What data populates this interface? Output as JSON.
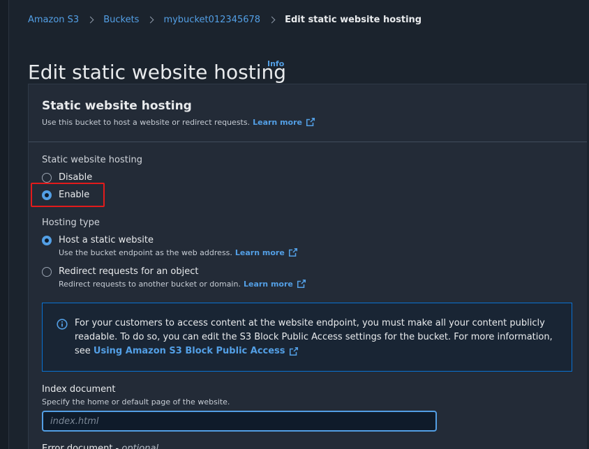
{
  "breadcrumb": {
    "items": [
      "Amazon S3",
      "Buckets",
      "mybucket012345678"
    ],
    "current": "Edit static website hosting"
  },
  "page": {
    "title": "Edit static website hosting",
    "info_label": "Info"
  },
  "panel": {
    "title": "Static website hosting",
    "description": "Use this bucket to host a website or redirect requests.",
    "learn_more": "Learn more"
  },
  "hosting": {
    "label": "Static website hosting",
    "options": [
      {
        "label": "Disable",
        "selected": false
      },
      {
        "label": "Enable",
        "selected": true
      }
    ]
  },
  "hosting_type": {
    "label": "Hosting type",
    "options": [
      {
        "label": "Host a static website",
        "description": "Use the bucket endpoint as the web address.",
        "learn_more": "Learn more",
        "selected": true
      },
      {
        "label": "Redirect requests for an object",
        "description": "Redirect requests to another bucket or domain.",
        "learn_more": "Learn more",
        "selected": false
      }
    ]
  },
  "alert": {
    "text": "For your customers to access content at the website endpoint, you must make all your content publicly readable. To do so, you can edit the S3 Block Public Access settings for the bucket. For more information, see",
    "link": "Using Amazon S3 Block Public Access"
  },
  "index_document": {
    "label": "Index document",
    "description": "Specify the home or default page of the website.",
    "placeholder": "index.html",
    "value": ""
  },
  "error_document": {
    "label": "Error document -",
    "optional": "optional"
  },
  "colors": {
    "background": "#1b232d",
    "panel": "#232b37",
    "link": "#539fe5",
    "highlight": "#e31b1b",
    "alert_border": "#0972d3"
  }
}
